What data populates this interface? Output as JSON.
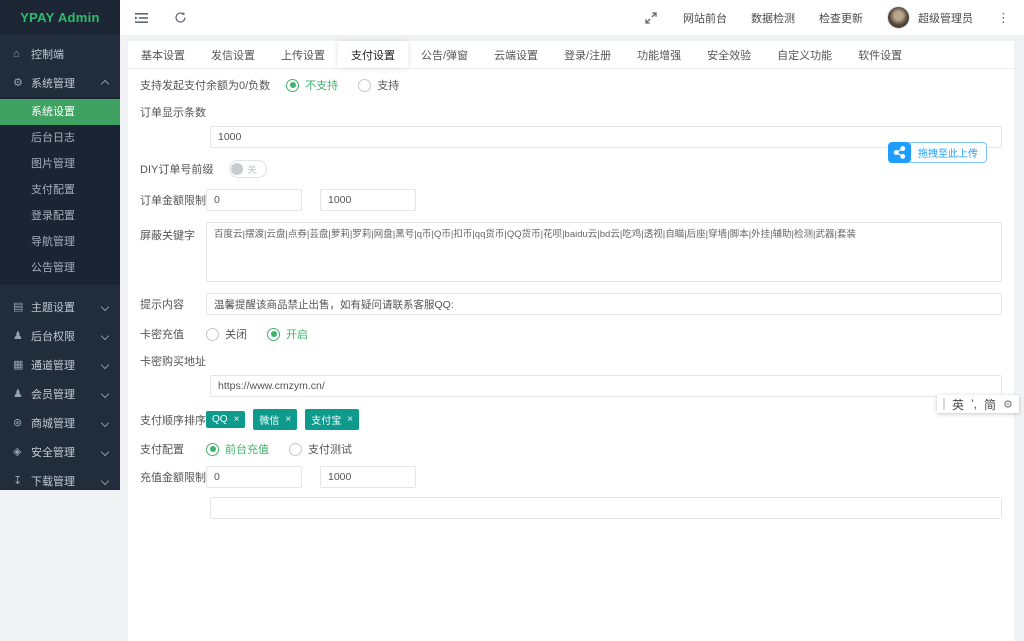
{
  "brand": {
    "title": "YPAY Admin"
  },
  "colors": {
    "brand_green": "#2bbf6c",
    "active_green": "#3fa162",
    "radio_green": "#3eb36e",
    "tag_teal": "#0e9a8d",
    "upload_blue": "#1e9fff",
    "sidebar_bg": "#222d3b"
  },
  "icons": {
    "home": "⌂",
    "gear": "⚙",
    "layout": "▤",
    "user": "♟",
    "grid": "▦",
    "mall": "⊛",
    "shield": "◈",
    "download": "↧",
    "more": "⋮",
    "ime_gear": "⚙"
  },
  "sidebar": {
    "items": [
      {
        "label": "控制端"
      },
      {
        "label": "系统管理",
        "expanded": true
      },
      {
        "label": "主题设置"
      },
      {
        "label": "后台权限"
      },
      {
        "label": "通道管理"
      },
      {
        "label": "会员管理"
      },
      {
        "label": "商城管理"
      },
      {
        "label": "安全管理"
      },
      {
        "label": "下载管理"
      }
    ],
    "submenu": [
      "系统设置",
      "后台日志",
      "图片管理",
      "支付配置",
      "登录配置",
      "导航管理",
      "公告管理"
    ],
    "active_submenu": "系统设置"
  },
  "topbar": {
    "links": [
      "网站前台",
      "数据检测",
      "检查更新"
    ],
    "username": "超级管理员"
  },
  "tabs": {
    "items": [
      "基本设置",
      "发信设置",
      "上传设置",
      "支付设置",
      "公告/弹窗",
      "云端设置",
      "登录/注册",
      "功能增强",
      "安全效验",
      "自定义功能",
      "软件设置"
    ],
    "active": "支付设置"
  },
  "form": {
    "balance_pay": {
      "label": "支持发起支付余额为0/负数",
      "option_no": "不支持",
      "option_yes": "支持",
      "selected": "不支持"
    },
    "order_count": {
      "label": "订单显示条数",
      "value": "1000"
    },
    "diy_prefix": {
      "label": "DIY订单号前缀",
      "toggle": "关",
      "state": "off"
    },
    "order_amount": {
      "label": "订单金额限制",
      "min": "0",
      "max": "1000"
    },
    "keywords": {
      "label": "屏蔽关键字",
      "value": "百度云|摆渡|云盘|点券|芸盘|萝莉|罗莉|网盘|黑号|q币|Q币|扣币|qq货币|QQ货币|花呗|baidu云|bd云|吃鸡|透视|自瞄|后座|穿墙|脚本|外挂|辅助|检测|武器|套装"
    },
    "tip": {
      "label": "提示内容",
      "value": "温馨提醒该商品禁止出售，如有疑问请联系客服QQ:"
    },
    "card_recharge": {
      "label": "卡密充值",
      "option_off": "关闭",
      "option_on": "开启",
      "selected": "开启"
    },
    "card_url": {
      "label": "卡密购买地址",
      "value": "https://www.cmzym.cn/"
    },
    "pay_order": {
      "label": "支付顺序排序",
      "tags": [
        "QQ",
        "微信",
        "支付宝"
      ],
      "remove": "×"
    },
    "pay_config": {
      "label": "支付配置",
      "option_front": "前台充值",
      "option_test": "支付测试",
      "selected": "前台充值"
    },
    "recharge_amount": {
      "label": "充值金额限制",
      "min": "0",
      "max": "1000"
    }
  },
  "upload": {
    "label": "拖拽至此上传"
  },
  "ime": {
    "en": "英",
    "punct": "’,",
    "simp": "简"
  }
}
